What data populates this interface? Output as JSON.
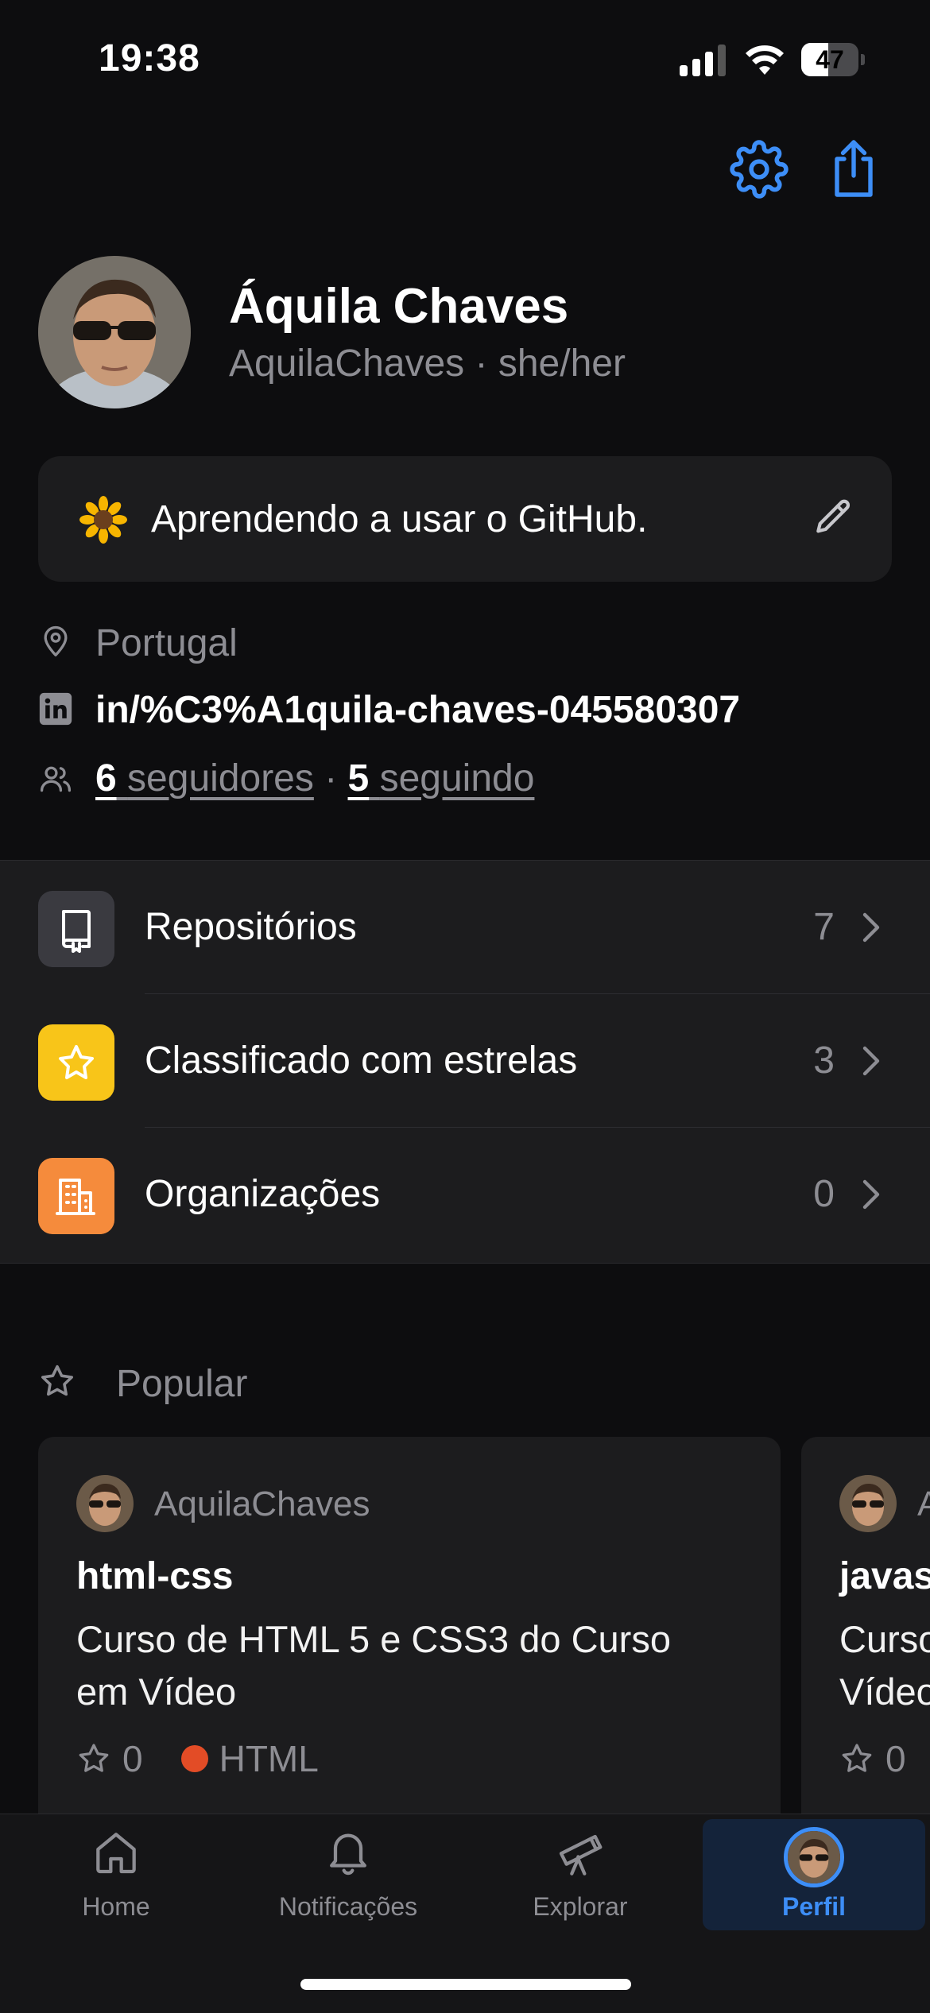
{
  "status_bar": {
    "time": "19:38",
    "battery": "47",
    "battery_level": 0.47
  },
  "profile": {
    "name": "Áquila Chaves",
    "handle": "AquilaChaves · she/her",
    "bio": "Aprendendo a usar o GitHub.",
    "bio_emoji": "sunflower",
    "location": "Portugal",
    "linkedin": "in/%C3%A1quila-chaves-045580307",
    "followers_count": "6",
    "followers_label": "seguidores",
    "separator": "·",
    "following_count": "5",
    "following_label": "seguindo"
  },
  "list": [
    {
      "label": "Repositórios",
      "count": "7",
      "icon": "repo-icon",
      "color": "#3a3a40"
    },
    {
      "label": "Classificado com estrelas",
      "count": "3",
      "icon": "star-icon",
      "color": "#f8c519"
    },
    {
      "label": "Organizações",
      "count": "0",
      "icon": "organization-icon",
      "color": "#f58b3c"
    }
  ],
  "popular": {
    "title": "Popular",
    "cards": [
      {
        "owner": "AquilaChaves",
        "name": "html-css",
        "desc_line1": "Curso de HTML 5 e CSS3 do Curso",
        "desc_line2": "em Vídeo",
        "stars": "0",
        "language": "HTML",
        "language_color": "#e34c26"
      },
      {
        "owner": "A",
        "name": "javas",
        "desc_line1": "Curso",
        "desc_line2": "Vídeo",
        "stars": "0"
      }
    ]
  },
  "tabs": [
    {
      "label": "Home",
      "icon": "home-icon"
    },
    {
      "label": "Notificações",
      "icon": "bell-icon"
    },
    {
      "label": "Explorar",
      "icon": "telescope-icon"
    },
    {
      "label": "Perfil",
      "icon": "avatar"
    }
  ],
  "colors": {
    "accent": "#3d8ef7",
    "background": "#0d0d0f",
    "card": "#1c1c1e",
    "muted": "#8d8d93"
  }
}
